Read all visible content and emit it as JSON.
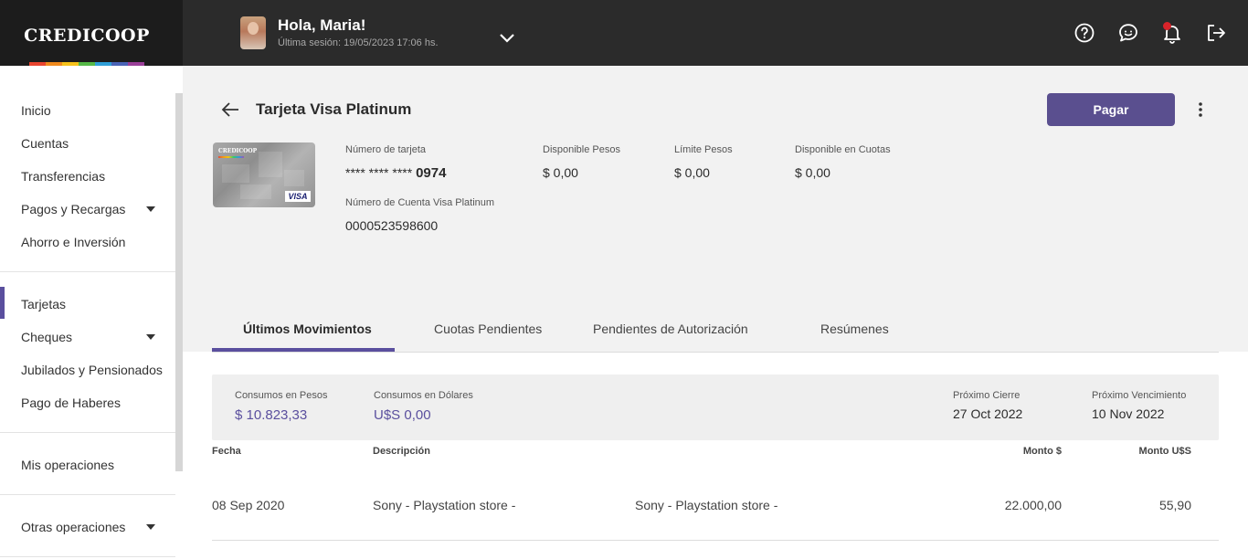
{
  "brand": {
    "name": "CREDICOOP",
    "rainbow": [
      "#e8452f",
      "#f08a1d",
      "#f6c21b",
      "#55b947",
      "#2f9fd8",
      "#4a63b7",
      "#9a3f98"
    ]
  },
  "header": {
    "greeting": "Hola, Maria!",
    "last_session": "Última sesión: 19/05/2023 17:06 hs.",
    "icons": [
      "help-icon",
      "chat-icon",
      "bell-icon",
      "logout-icon"
    ]
  },
  "sidebar": {
    "items": [
      {
        "label": "Inicio"
      },
      {
        "label": "Cuentas"
      },
      {
        "label": "Transferencias"
      },
      {
        "label": "Pagos y Recargas"
      },
      {
        "label": "Ahorro e Inversión"
      },
      {
        "label": "Tarjetas"
      },
      {
        "label": "Cheques"
      },
      {
        "label": "Jubilados y Pensionados"
      },
      {
        "label": "Pago de Haberes"
      },
      {
        "label": "Mis operaciones"
      },
      {
        "label": "Otras operaciones"
      }
    ]
  },
  "page": {
    "title": "Tarjeta Visa Platinum",
    "pay_label": "Pagar"
  },
  "card": {
    "brand_text": "CREDICOOP",
    "network": "VISA",
    "number_label": "Número de tarjeta",
    "number_masked": "**** **** ****",
    "number_last4": "0974",
    "account_label": "Número de Cuenta Visa Platinum",
    "account_value": "0000523598600",
    "available_pesos_label": "Disponible Pesos",
    "available_pesos_value": "$ 0,00",
    "limit_pesos_label": "Límite Pesos",
    "limit_pesos_value": "$ 0,00",
    "available_installments_label": "Disponible en Cuotas",
    "available_installments_value": "$ 0,00"
  },
  "tabs": [
    {
      "label": "Últimos Movimientos"
    },
    {
      "label": "Cuotas Pendientes"
    },
    {
      "label": "Pendientes de Autorización"
    },
    {
      "label": "Resúmenes"
    }
  ],
  "summary": {
    "consumos_pesos_label": "Consumos en Pesos",
    "consumos_pesos_value": "$ 10.823,33",
    "consumos_dolares_label": "Consumos en Dólares",
    "consumos_dolares_value": "U$S 0,00",
    "proximo_cierre_label": "Próximo Cierre",
    "proximo_cierre_value": "27 Oct 2022",
    "proximo_vencimiento_label": "Próximo Vencimiento",
    "proximo_vencimiento_value": "10 Nov 2022"
  },
  "table": {
    "columns": [
      "Fecha",
      "Descripción",
      "Monto $",
      "Monto U$S"
    ],
    "rows": [
      {
        "fecha": "08 Sep 2020",
        "descripcion": "Sony - Playstation store -",
        "detalle": "Sony - Playstation store -",
        "monto_pesos": "22.000,00",
        "monto_usd": "55,90"
      }
    ]
  },
  "colors": {
    "accent": "#5a4f9e",
    "topbar": "#2b2b2b",
    "notification": "#d8232a"
  }
}
